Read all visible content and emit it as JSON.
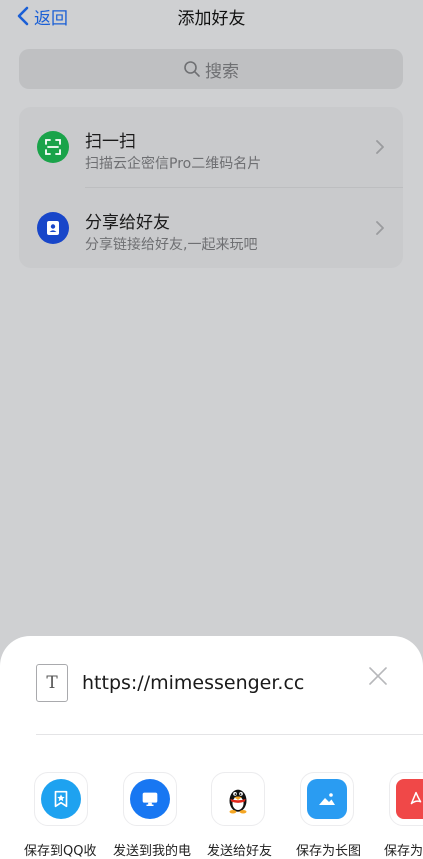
{
  "header": {
    "back_label": "返回",
    "title": "添加好友"
  },
  "search": {
    "label": "搜索"
  },
  "options": [
    {
      "title": "扫一扫",
      "subtitle": "扫描云企密信Pro二维码名片",
      "icon": "scan-icon",
      "color": "#1aa34a"
    },
    {
      "title": "分享给好友",
      "subtitle": "分享链接给好友,一起来玩吧",
      "icon": "contact-card-icon",
      "color": "#1846c9"
    }
  ],
  "share_sheet": {
    "url": "https://mimessenger.cc",
    "targets": [
      {
        "label": "保存到QQ收",
        "icon": "qq-favorites-icon"
      },
      {
        "label": "发送到我的电",
        "icon": "my-computer-icon"
      },
      {
        "label": "发送给好友",
        "icon": "qq-penguin-icon"
      },
      {
        "label": "保存为长图",
        "icon": "long-image-icon"
      },
      {
        "label": "保存为",
        "icon": "pdf-icon"
      }
    ]
  }
}
